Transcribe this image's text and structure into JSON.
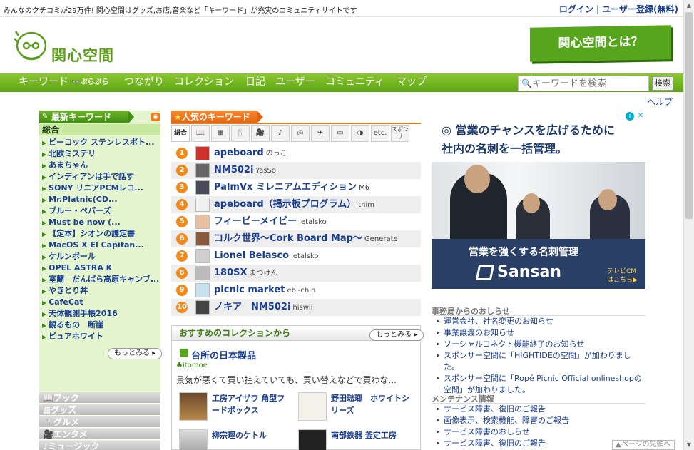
{
  "header": {
    "tagline": "みんなのクチコミが29万件! 関心空間はグッズ,お店,音楽など「キーワード」が充実のコミュニティサイトです",
    "login": "ログイン",
    "separator": "|",
    "register": "ユーザー登録(無料)",
    "logo_text": "関心空間",
    "about_button": "関心空間とは？"
  },
  "nav": {
    "items": [
      "キーワード",
      "ぷらぷら",
      "つながり",
      "コレクション",
      "日記",
      "ユーザー",
      "コミュニティ",
      "マップ"
    ],
    "search_placeholder": "キーワードを検索",
    "search_button": "検索",
    "help": "ヘルプ"
  },
  "latest": {
    "title": "最新キーワード",
    "sub": "総合",
    "items": [
      "ピーコック ステンレスポト...",
      "北欧ミステリ",
      "あまちゃん",
      "インディアンは手で話す",
      "SONY リニアPCMレコ...",
      "Mr.Platnic(CD...",
      "ブルー・ペパーズ",
      "Must be now (...",
      "【定本】シオンの護定書",
      "MacOS X El Capitan...",
      "ケルンボール",
      "OPEL ASTRA K",
      "室蘭　だんばら高原キャンプ...",
      "やきとり丼",
      "CafeCat",
      "天体観測手帳2016",
      "観るもの　断崖",
      "ピュアホワイト"
    ],
    "more": "もっとみる",
    "categories": [
      "ブック",
      "グッズ",
      "グルメ",
      "エンタメ",
      "ミュージック"
    ]
  },
  "popular": {
    "title": "人気のキーワード",
    "tabs": [
      "総合",
      "📖",
      "▦",
      "🍴",
      "🎥",
      "♪",
      "◎",
      "✈",
      "▭",
      "◑",
      "etc.",
      "スポンサ"
    ],
    "ranks": [
      {
        "n": "1",
        "title": "apeboard",
        "user": "のっこ"
      },
      {
        "n": "2",
        "title": "NM502i",
        "user": "YasSo"
      },
      {
        "n": "3",
        "title": "PalmVx ミレニアムエディション",
        "user": "M6"
      },
      {
        "n": "4",
        "title": "apeboard（掲示板プログラム）",
        "user": "thim"
      },
      {
        "n": "5",
        "title": "フィービーメイビー",
        "user": "letalsko"
      },
      {
        "n": "6",
        "title": "コルク世界～Cork Board Map～",
        "user": "Generate"
      },
      {
        "n": "7",
        "title": "Lionel Belasco",
        "user": "letalsko"
      },
      {
        "n": "8",
        "title": "180SX",
        "user": "まつけん"
      },
      {
        "n": "9",
        "title": "picnic market",
        "user": "ebi-chin"
      },
      {
        "n": "10",
        "title": "ノキア　NM502i",
        "user": "hiswii"
      }
    ]
  },
  "collection": {
    "title": "おすすめのコレクションから",
    "more": "もっとみる",
    "name": "台所の日本製品",
    "user": "itomoe",
    "desc": "景気が悪くて買い控えていても、買い替えなどで買わな...",
    "items": [
      "工房アイザワ 角型フードボックス",
      "野田琺瑯　ホワイトシリーズ",
      "柳宗理のケトル",
      "南部鉄器 釜定工房"
    ]
  },
  "ad": {
    "line1": "営業のチャンスを広げるために",
    "line2": "社内の名刺を一括管理。",
    "bottom1": "営業を強くする名刺管理",
    "brand": "Sansan",
    "cm1": "テレビCM",
    "cm2": "はこちら▶"
  },
  "news": {
    "title": "事務局からのおしらせ",
    "items": [
      "運営会社、社名変更のお知らせ",
      "事業譲渡のお知らせ",
      "ソーシャルコネクト機能終了のお知らせ",
      "スポンサー空間に「HIGHTIDEの空間」が加わりました。",
      "スポンサー空間に「Ropé Picnic Official onlineshopの空間」が加わりました。"
    ]
  },
  "maint": {
    "title": "メンテナンス情報",
    "items": [
      "サービス障害、復旧のご報告",
      "画像表示、検索機能、障害のご報告",
      "サービス障害のおしらせ",
      "サービス障害、復旧のご報告"
    ]
  },
  "pagetop": "▲ページの先頭へ"
}
